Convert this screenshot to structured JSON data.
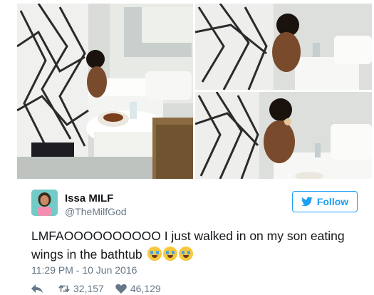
{
  "user": {
    "display_name": "Issa MILF",
    "handle": "@TheMilfGod"
  },
  "follow": {
    "label": "Follow",
    "icon": "twitter-bird-icon"
  },
  "tweet": {
    "text": "LMFAOOOOOOOOOO I just walked in on my son eating wings in the bathtub",
    "emojis": [
      "loudly-crying-face",
      "loudly-crying-face",
      "loudly-crying-face"
    ],
    "timestamp": "11:29 PM - 10 Jun 2016"
  },
  "stats": {
    "retweets": "32,157",
    "likes": "46,129"
  },
  "icons": {
    "reply": "reply-icon",
    "retweet": "retweet-icon",
    "like": "heart-icon"
  },
  "colors": {
    "accent": "#1da1f2",
    "text": "#14171a",
    "muted": "#657786"
  }
}
